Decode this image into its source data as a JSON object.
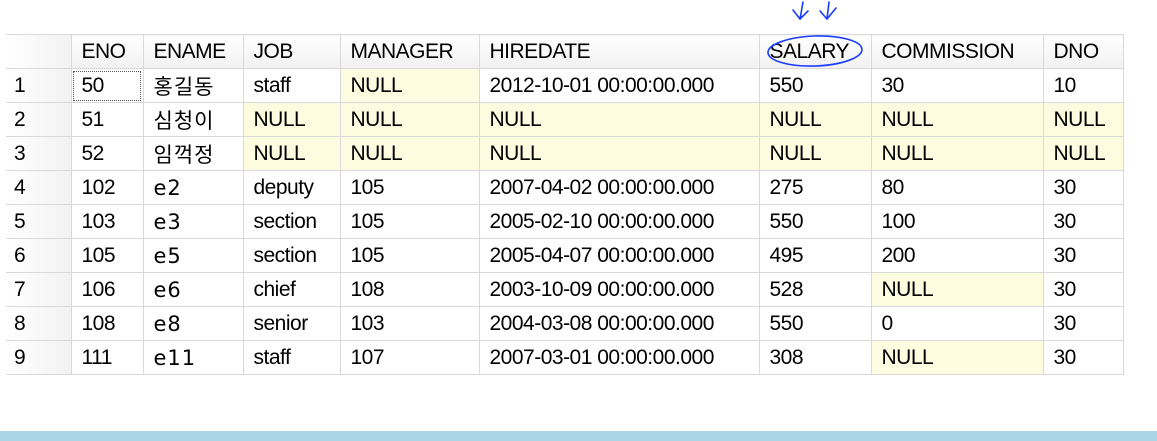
{
  "grid": {
    "columns": [
      "",
      "ENO",
      "ENAME",
      "JOB",
      "MANAGER",
      "HIREDATE",
      "SALARY",
      "COMMISSION",
      "DNO"
    ],
    "rows": [
      [
        "1",
        "50",
        "홍길동",
        "staff",
        "NULL",
        "2012-10-01 00:00:00.000",
        "550",
        "30",
        "10"
      ],
      [
        "2",
        "51",
        "심청이",
        "NULL",
        "NULL",
        "NULL",
        "NULL",
        "NULL",
        "NULL"
      ],
      [
        "3",
        "52",
        "임꺽정",
        "NULL",
        "NULL",
        "NULL",
        "NULL",
        "NULL",
        "NULL"
      ],
      [
        "4",
        "102",
        "e2",
        "deputy",
        "105",
        "2007-04-02 00:00:00.000",
        "275",
        "80",
        "30"
      ],
      [
        "5",
        "103",
        "e3",
        "section",
        "105",
        "2005-02-10 00:00:00.000",
        "550",
        "100",
        "30"
      ],
      [
        "6",
        "105",
        "e5",
        "section",
        "105",
        "2005-04-07 00:00:00.000",
        "495",
        "200",
        "30"
      ],
      [
        "7",
        "106",
        "e6",
        "chief",
        "108",
        "2003-10-09 00:00:00.000",
        "528",
        "NULL",
        "30"
      ],
      [
        "8",
        "108",
        "e8",
        "senior",
        "103",
        "2004-03-08 00:00:00.000",
        "550",
        "0",
        "30"
      ],
      [
        "9",
        "111",
        "e11",
        "staff",
        "107",
        "2007-03-01 00:00:00.000",
        "308",
        "NULL",
        "30"
      ]
    ]
  },
  "colors": {
    "null_cell": "#fdfbe0",
    "annotation": "#1a3cff",
    "bottom_bar": "#a8d4e6"
  }
}
